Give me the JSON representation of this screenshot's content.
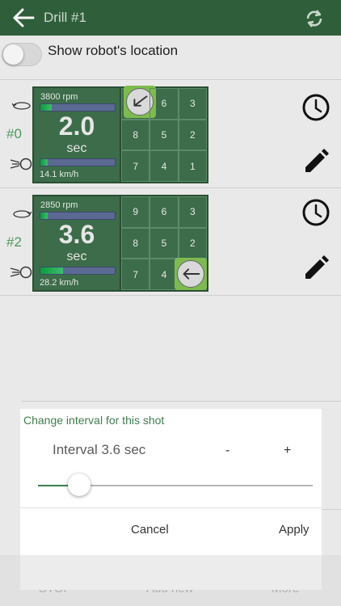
{
  "header": {
    "title": "Drill #1",
    "back_icon": "arrow-left-icon",
    "sync_icon": "sync-icon"
  },
  "robot_location": {
    "label": "Show robot's location",
    "enabled": false
  },
  "shots": [
    {
      "id": "#0",
      "rpm": "3800 rpm",
      "rpm_level": 0.15,
      "interval": "2.0",
      "unit": "sec",
      "speed": "14.1 km/h",
      "speed_level": 0.1,
      "grid": [
        "",
        "6",
        "3",
        "8",
        "5",
        "2",
        "7",
        "4",
        "1"
      ],
      "target_cell": 0
    },
    {
      "id": "#2",
      "rpm": "2850 rpm",
      "rpm_level": 0.1,
      "interval": "3.6",
      "unit": "sec",
      "speed": "28.2 km/h",
      "speed_level": 0.3,
      "grid": [
        "9",
        "6",
        "3",
        "8",
        "5",
        "2",
        "7",
        "4",
        ""
      ],
      "target_cell": 8
    }
  ],
  "dialog": {
    "title": "Change interval for this shot",
    "interval_label": "Interval 3.6 sec",
    "minus": "-",
    "plus": "+",
    "slider_value": 0.15,
    "cancel": "Cancel",
    "apply": "Apply"
  },
  "bottom_bar": {
    "stop": "STOP",
    "add_new": "Add new",
    "more": "More"
  },
  "colors": {
    "header": "#2f5f3a",
    "accent": "#3f7d4e",
    "card": "#3c6c49",
    "target": "#7dbb4f"
  }
}
